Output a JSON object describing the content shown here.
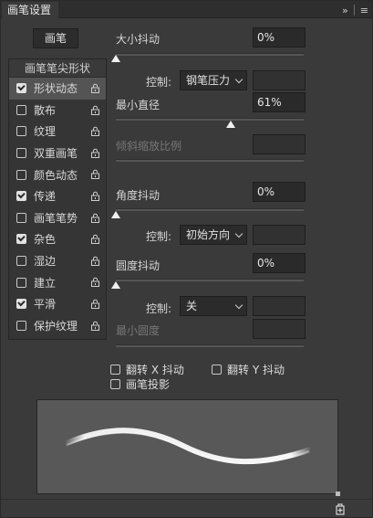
{
  "panel": {
    "tab_title": "画笔设置",
    "collapse_icon": "double-chevron-right-icon",
    "menu_icon": "hamburger-menu-icon"
  },
  "preset_button": "画笔",
  "sidebar": {
    "header": "画笔笔尖形状",
    "items": [
      {
        "label": "形状动态",
        "checked": true,
        "active": true
      },
      {
        "label": "散布",
        "checked": false
      },
      {
        "label": "纹理",
        "checked": false
      },
      {
        "label": "双重画笔",
        "checked": false
      },
      {
        "label": "颜色动态",
        "checked": false
      },
      {
        "label": "传递",
        "checked": true
      },
      {
        "label": "画笔笔势",
        "checked": false
      },
      {
        "label": "杂色",
        "checked": true
      },
      {
        "label": "湿边",
        "checked": false
      },
      {
        "label": "建立",
        "checked": false
      },
      {
        "label": "平滑",
        "checked": true
      },
      {
        "label": "保护纹理",
        "checked": false
      }
    ]
  },
  "settings": {
    "size_jitter": {
      "label": "大小抖动",
      "value": "0%",
      "level": 0
    },
    "size_control": {
      "label": "控制:",
      "value": "钢笔压力",
      "extra": ""
    },
    "min_diameter": {
      "label": "最小直径",
      "value": "61%",
      "level": 0.61
    },
    "tilt_scale": {
      "label": "倾斜缩放比例",
      "value": ""
    },
    "angle_jitter": {
      "label": "角度抖动",
      "value": "0%",
      "level": 0
    },
    "angle_control": {
      "label": "控制:",
      "value": "初始方向",
      "extra": ""
    },
    "roundness_jitter": {
      "label": "圆度抖动",
      "value": "0%",
      "level": 0
    },
    "roundness_control": {
      "label": "控制:",
      "value": "关",
      "extra": ""
    },
    "min_roundness": {
      "label": "最小圆度",
      "value": ""
    }
  },
  "options": {
    "flip_x": {
      "label": "翻转 X 抖动",
      "checked": false
    },
    "flip_y": {
      "label": "翻转 Y 抖动",
      "checked": false
    },
    "brush_projection": {
      "label": "画笔投影",
      "checked": false
    }
  },
  "footer": {
    "new_icon": "new-brush-icon"
  },
  "colors": {
    "panel_bg": "#3a3a3a",
    "field_bg": "#2a2a2a",
    "active_row": "#545454",
    "preview_bg": "#585858",
    "stroke": "#ffffff"
  }
}
